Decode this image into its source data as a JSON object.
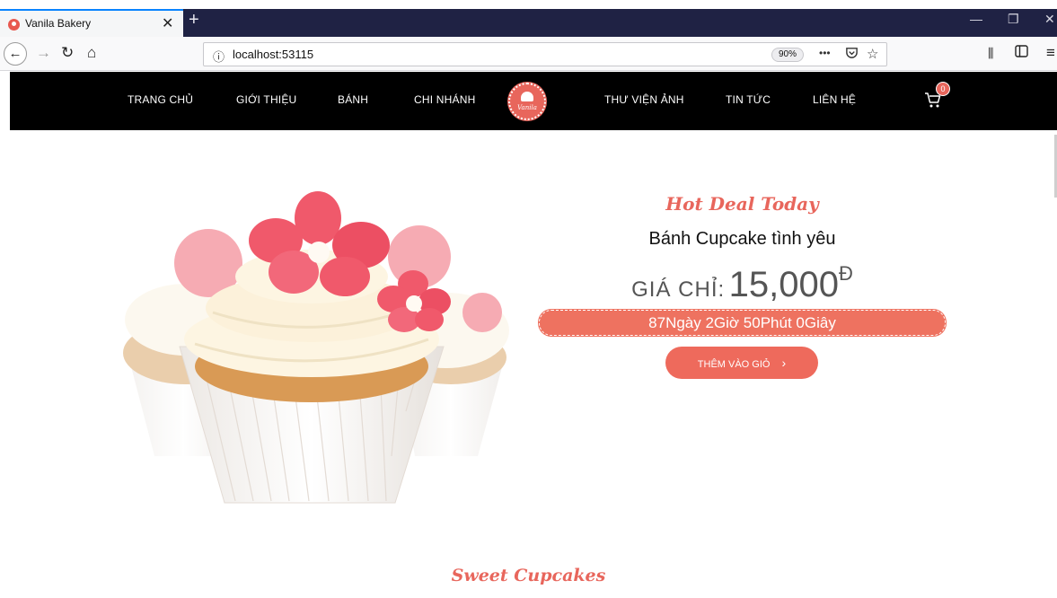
{
  "browser": {
    "tab_title": "Vanila Bakery",
    "tab_close": "✕",
    "new_tab": "+",
    "url": "localhost:53115",
    "zoom": "90%",
    "info_icon": "ⓘ",
    "page_actions": "•••",
    "window_minimize": "—",
    "window_restore": "❐",
    "window_close": "✕"
  },
  "nav": {
    "items": [
      "TRANG CHỦ",
      "GIỚI THIỆU",
      "BÁNH",
      "CHI NHÁNH",
      "THƯ VIỆN ẢNH",
      "TIN TỨC",
      "LIÊN HỆ"
    ],
    "logo_text": "Vanila",
    "cart_count": "0"
  },
  "hero": {
    "tagline": "Hot Deal Today",
    "product_name": "Bánh Cupcake tình yêu",
    "price_prefix": "GIÁ CHỈ:",
    "price_value": "15,000",
    "price_currency": "Đ",
    "countdown": "87Ngày 2Giờ 50Phút 0Giây",
    "button_label": "THÊM VÀO GIỎ",
    "button_icon": "›"
  },
  "section": {
    "title": "Sweet Cupcakes"
  },
  "colors": {
    "accent": "#e8665c",
    "header_bg": "#000000",
    "tabstrip_bg": "#1f2244"
  }
}
